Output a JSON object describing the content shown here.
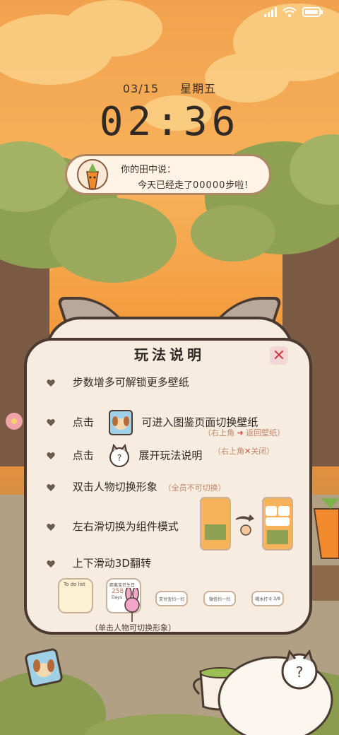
{
  "status_bar": {
    "signal_icon": "signal-icon",
    "wifi_icon": "wifi-icon",
    "battery_icon": "battery-icon"
  },
  "lockscreen": {
    "date": "03/15",
    "weekday": "星期五",
    "time": "02:36"
  },
  "speech_bubble": {
    "line1": "你的田中说：",
    "line2_prefix": "今天已经走了",
    "steps": "00000",
    "line2_suffix": "步啦！"
  },
  "help_card": {
    "title": "玩法说明",
    "close_icon": "close-icon",
    "rows": [
      {
        "text": "步数增多可解锁更多壁纸"
      },
      {
        "prefix": "点击",
        "text": "可进入图鉴页面切换壁纸",
        "note_a": "（右上角",
        "note_b": "返回壁纸）"
      },
      {
        "prefix": "点击",
        "text": "展开玩法说明",
        "note_a": "（右上角",
        "note_b": "关闭）"
      },
      {
        "text": "双击人物切换形象",
        "note": "（全员不可切换）"
      },
      {
        "text": "左右滑切换为组件模式"
      },
      {
        "text": "上下滑动3D翻转"
      }
    ],
    "widgets": [
      {
        "label": "To do list"
      },
      {
        "label": "距离宝贝生日",
        "days": "258",
        "unit": "Days"
      },
      {
        "label": "支付宝扫一扫",
        "sub": "Alipay"
      },
      {
        "label": "微信扫一扫",
        "sub": "Wechat"
      },
      {
        "label": "喝水打卡",
        "count": "3/8"
      }
    ],
    "widget_caption": "（单击人物可切换形象）"
  },
  "colors": {
    "sky_top": "#f2a24e",
    "card_bg": "#f6ecdf",
    "card_border": "#4a3a30",
    "accent_red": "#d2473f"
  }
}
